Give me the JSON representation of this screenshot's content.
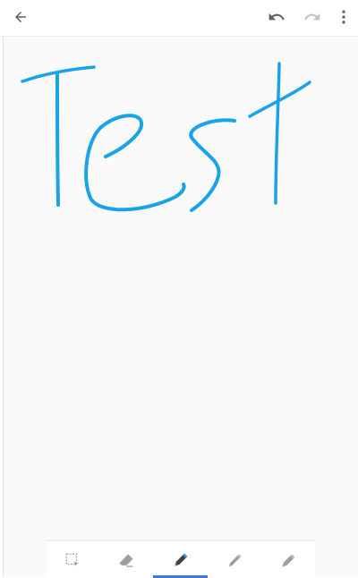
{
  "colors": {
    "ink": "#1aa3e8",
    "icon": "#616161",
    "icon_disabled": "#c4c4c4",
    "tool_icon": "#9e9e9e",
    "accent": "#3b78e7"
  },
  "topbar": {
    "back_icon": "arrow-left-icon",
    "undo_icon": "undo-icon",
    "redo_icon": "redo-icon",
    "more_icon": "more-vert-icon"
  },
  "tools": [
    {
      "icon": "lasso-select-icon",
      "selected": false
    },
    {
      "icon": "eraser-icon",
      "selected": false
    },
    {
      "icon": "pen-icon",
      "selected": true
    },
    {
      "icon": "marker-icon",
      "selected": false
    },
    {
      "icon": "highlighter-icon",
      "selected": false
    }
  ]
}
